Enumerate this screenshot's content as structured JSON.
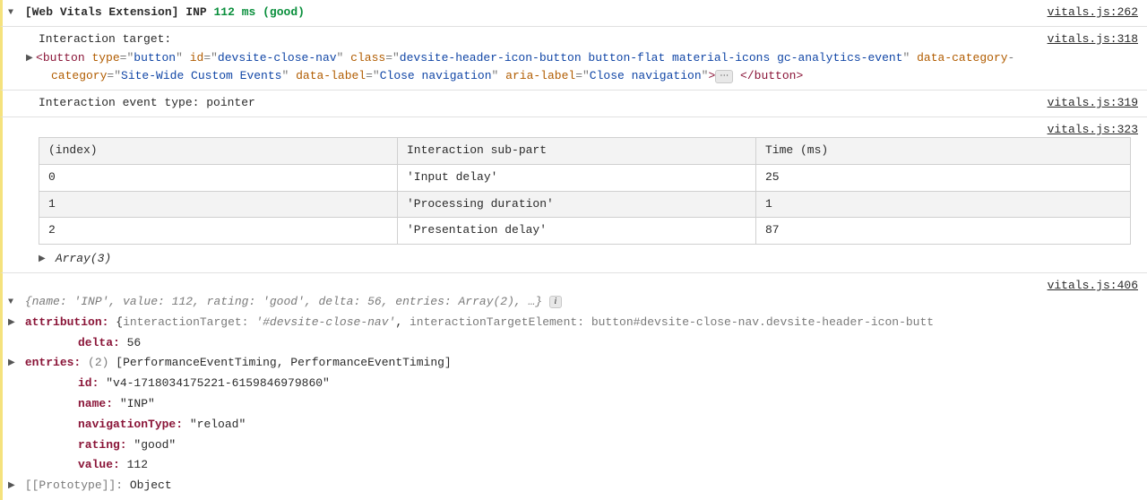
{
  "entries": [
    {
      "prefix": "[Web Vitals Extension]",
      "metric": "INP",
      "value": "112 ms",
      "rating": "(good)",
      "source": "vitals.js:262"
    },
    {
      "label": "Interaction target:",
      "source": "vitals.js:318",
      "html": {
        "open_tag": "<",
        "tag": "button",
        "attrs": [
          {
            "name": "type",
            "value": "button"
          },
          {
            "name": "id",
            "value": "devsite-close-nav"
          },
          {
            "name": "class",
            "value": "devsite-header-icon-button button-flat material-icons gc-analytics-event"
          },
          {
            "name": "data-category",
            "value": "Site-Wide Custom Events"
          },
          {
            "name": "data-label",
            "value": "Close navigation"
          },
          {
            "name": "aria-label",
            "value": "Close navigation"
          }
        ],
        "ellipsis": "⋯",
        "close": "</button>"
      }
    },
    {
      "text": "Interaction event type: pointer",
      "source": "vitals.js:319"
    },
    {
      "source": "vitals.js:323",
      "table": {
        "headers": [
          "(index)",
          "Interaction sub-part",
          "Time (ms)"
        ],
        "rows": [
          [
            "0",
            "'Input delay'",
            "25"
          ],
          [
            "1",
            "'Processing duration'",
            "1"
          ],
          [
            "2",
            "'Presentation delay'",
            "87"
          ]
        ],
        "array_label": "Array(3)"
      }
    },
    {
      "source": "vitals.js:406",
      "summary": "{name: 'INP', value: 112, rating: 'good', delta: 56, entries: Array(2), …}",
      "props": {
        "attribution": {
          "key": "attribution:",
          "open": "{",
          "p1_key": "interactionTarget:",
          "p1_val": "'#devsite-close-nav'",
          "p2_key": "interactionTargetElement:",
          "p2_val": "button#devsite-close-nav.devsite-header-icon-butt",
          "comma": ","
        },
        "delta": {
          "key": "delta:",
          "val": "56"
        },
        "entries": {
          "key": "entries:",
          "count": "(2)",
          "val": "[PerformanceEventTiming, PerformanceEventTiming]"
        },
        "id": {
          "key": "id:",
          "val": "\"v4-1718034175221-6159846979860\""
        },
        "name": {
          "key": "name:",
          "val": "\"INP\""
        },
        "navigationType": {
          "key": "navigationType:",
          "val": "\"reload\""
        },
        "rating": {
          "key": "rating:",
          "val": "\"good\""
        },
        "value": {
          "key": "value:",
          "val": "112"
        },
        "prototype": {
          "key": "[[Prototype]]:",
          "val": "Object"
        }
      }
    }
  ]
}
